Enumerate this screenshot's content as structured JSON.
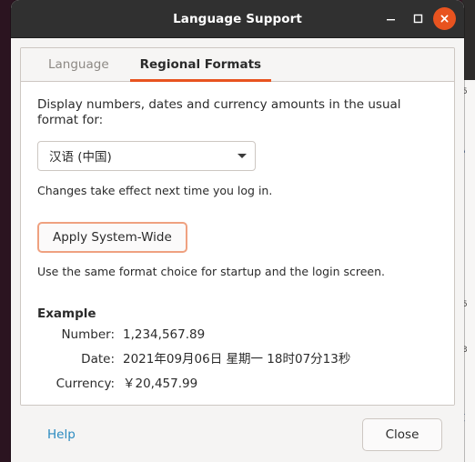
{
  "window": {
    "title": "Language Support",
    "controls": {
      "minimize_label": "Minimize",
      "maximize_label": "Maximize",
      "close_label": "Close window"
    }
  },
  "tabs": [
    {
      "id": "language",
      "label": "Language",
      "active": false
    },
    {
      "id": "regional-formats",
      "label": "Regional Formats",
      "active": true
    }
  ],
  "page": {
    "description": "Display numbers, dates and currency amounts in the usual format for:",
    "locale_select": {
      "value": "汉语 (中国)",
      "caret_icon": "chevron-down-icon"
    },
    "changes_hint": "Changes take effect next time you log in.",
    "apply_button_label": "Apply System-Wide",
    "apply_hint": "Use the same format choice for startup and the login screen.",
    "example": {
      "title": "Example",
      "rows": [
        {
          "label": "Number:",
          "value": "1,234,567.89"
        },
        {
          "label": "Date:",
          "value": "2021年09月06日 星期一 18时07分13秒"
        },
        {
          "label": "Currency:",
          "value": "￥20,457.99"
        }
      ]
    }
  },
  "actionbar": {
    "help_label": "Help",
    "close_label": "Close"
  },
  "colors": {
    "accent": "#e8531f",
    "titlebar": "#303030",
    "window_bg": "#f5f4f3",
    "link": "#2a8ac0",
    "focus_ring": "#efa180",
    "border": "#cdc7c2"
  }
}
